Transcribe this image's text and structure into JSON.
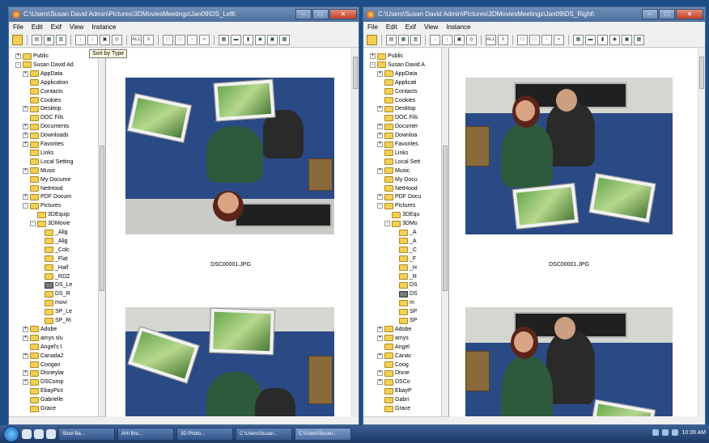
{
  "left_window": {
    "title": "C:\\Users\\Susan David Admin\\Pictures\\3DMoviesMeetings\\Jan09\\DS_Left\\",
    "menu": [
      "File",
      "Edit",
      "Exif",
      "View",
      "Instance"
    ],
    "tooltip": "Sort by Type",
    "tree": [
      {
        "label": "Public",
        "depth": 2,
        "exp": "+"
      },
      {
        "label": "Susan David Ad",
        "depth": 2,
        "exp": "-"
      },
      {
        "label": "AppData",
        "depth": 3,
        "exp": "+"
      },
      {
        "label": "Application",
        "depth": 3,
        "exp": ""
      },
      {
        "label": "Contacts",
        "depth": 3,
        "exp": ""
      },
      {
        "label": "Cookies",
        "depth": 3,
        "exp": ""
      },
      {
        "label": "Desktop",
        "depth": 3,
        "exp": "+"
      },
      {
        "label": "DOC Fils",
        "depth": 3,
        "exp": ""
      },
      {
        "label": "Documents",
        "depth": 3,
        "exp": "+"
      },
      {
        "label": "Downloads",
        "depth": 3,
        "exp": "+"
      },
      {
        "label": "Favorites",
        "depth": 3,
        "exp": "+"
      },
      {
        "label": "Links",
        "depth": 3,
        "exp": ""
      },
      {
        "label": "Local Setting",
        "depth": 3,
        "exp": ""
      },
      {
        "label": "Music",
        "depth": 3,
        "exp": "+"
      },
      {
        "label": "My Docume",
        "depth": 3,
        "exp": ""
      },
      {
        "label": "NetHood",
        "depth": 3,
        "exp": ""
      },
      {
        "label": "PDF Docum",
        "depth": 3,
        "exp": "+"
      },
      {
        "label": "Pictures",
        "depth": 3,
        "exp": "-"
      },
      {
        "label": "3DEquip",
        "depth": 4,
        "exp": ""
      },
      {
        "label": "3DMovie",
        "depth": 4,
        "exp": "-"
      },
      {
        "label": "_Alig",
        "depth": 5,
        "exp": ""
      },
      {
        "label": "_Alig",
        "depth": 5,
        "exp": ""
      },
      {
        "label": "_Colc",
        "depth": 5,
        "exp": ""
      },
      {
        "label": "_Flat",
        "depth": 5,
        "exp": ""
      },
      {
        "label": "_Half",
        "depth": 5,
        "exp": ""
      },
      {
        "label": "_RDZ",
        "depth": 5,
        "exp": ""
      },
      {
        "label": "DS_Le",
        "depth": 5,
        "exp": "",
        "img": true
      },
      {
        "label": "DS_R",
        "depth": 5,
        "exp": ""
      },
      {
        "label": "movi",
        "depth": 5,
        "exp": ""
      },
      {
        "label": "SP_Le",
        "depth": 5,
        "exp": ""
      },
      {
        "label": "SP_Ri",
        "depth": 5,
        "exp": ""
      },
      {
        "label": "Adobe",
        "depth": 3,
        "exp": "+"
      },
      {
        "label": "amys slu",
        "depth": 3,
        "exp": "+"
      },
      {
        "label": "Angel's I",
        "depth": 3,
        "exp": ""
      },
      {
        "label": "Canada2",
        "depth": 3,
        "exp": "+"
      },
      {
        "label": "Coogan",
        "depth": 3,
        "exp": ""
      },
      {
        "label": "Disneylar",
        "depth": 3,
        "exp": "+"
      },
      {
        "label": "DSComp",
        "depth": 3,
        "exp": "+"
      },
      {
        "label": "EbayPict",
        "depth": 3,
        "exp": ""
      },
      {
        "label": "Gabrielle",
        "depth": 3,
        "exp": ""
      },
      {
        "label": "Grace",
        "depth": 3,
        "exp": ""
      }
    ],
    "caption": "DSC00001.JPG"
  },
  "right_window": {
    "title": "C:\\Users\\Susan David Admin\\Pictures\\3DMoviesMeetings\\Jan09\\DS_Right\\",
    "menu": [
      "File",
      "Edit",
      "Exif",
      "View",
      "Instance"
    ],
    "tree": [
      {
        "label": "Public",
        "depth": 2,
        "exp": "+"
      },
      {
        "label": "Susan David A",
        "depth": 2,
        "exp": "-"
      },
      {
        "label": "AppData",
        "depth": 3,
        "exp": "+"
      },
      {
        "label": "Applicati",
        "depth": 3,
        "exp": ""
      },
      {
        "label": "Contacts",
        "depth": 3,
        "exp": ""
      },
      {
        "label": "Cookies",
        "depth": 3,
        "exp": ""
      },
      {
        "label": "Desktop",
        "depth": 3,
        "exp": "+"
      },
      {
        "label": "DOC Fils",
        "depth": 3,
        "exp": ""
      },
      {
        "label": "Documer",
        "depth": 3,
        "exp": "+"
      },
      {
        "label": "Downloa",
        "depth": 3,
        "exp": "+"
      },
      {
        "label": "Favorites",
        "depth": 3,
        "exp": "+"
      },
      {
        "label": "Links",
        "depth": 3,
        "exp": ""
      },
      {
        "label": "Local Sett",
        "depth": 3,
        "exp": ""
      },
      {
        "label": "Music",
        "depth": 3,
        "exp": "+"
      },
      {
        "label": "My Docu",
        "depth": 3,
        "exp": ""
      },
      {
        "label": "NetHood",
        "depth": 3,
        "exp": ""
      },
      {
        "label": "PDF Docu",
        "depth": 3,
        "exp": "+"
      },
      {
        "label": "Pictures",
        "depth": 3,
        "exp": "-"
      },
      {
        "label": "3DEqu",
        "depth": 4,
        "exp": ""
      },
      {
        "label": "3DMo",
        "depth": 4,
        "exp": "-"
      },
      {
        "label": "_A",
        "depth": 5,
        "exp": ""
      },
      {
        "label": "_A",
        "depth": 5,
        "exp": ""
      },
      {
        "label": "_C",
        "depth": 5,
        "exp": ""
      },
      {
        "label": "_F",
        "depth": 5,
        "exp": ""
      },
      {
        "label": "_H",
        "depth": 5,
        "exp": ""
      },
      {
        "label": "_R",
        "depth": 5,
        "exp": ""
      },
      {
        "label": "DS",
        "depth": 5,
        "exp": ""
      },
      {
        "label": "DS",
        "depth": 5,
        "exp": "",
        "img": true
      },
      {
        "label": "m",
        "depth": 5,
        "exp": ""
      },
      {
        "label": "SP",
        "depth": 5,
        "exp": ""
      },
      {
        "label": "SP",
        "depth": 5,
        "exp": ""
      },
      {
        "label": "Adobe",
        "depth": 3,
        "exp": "+"
      },
      {
        "label": "amys",
        "depth": 3,
        "exp": "+"
      },
      {
        "label": "Angel",
        "depth": 3,
        "exp": ""
      },
      {
        "label": "Canac",
        "depth": 3,
        "exp": "+"
      },
      {
        "label": "Coog",
        "depth": 3,
        "exp": ""
      },
      {
        "label": "Disne",
        "depth": 3,
        "exp": "+"
      },
      {
        "label": "DSCo",
        "depth": 3,
        "exp": "+"
      },
      {
        "label": "EbayP",
        "depth": 3,
        "exp": ""
      },
      {
        "label": "Gabri",
        "depth": 3,
        "exp": ""
      },
      {
        "label": "Grace",
        "depth": 3,
        "exp": ""
      }
    ],
    "caption": "DSC00001.JPG"
  },
  "toolbar_icons": [
    "folder-icon",
    "view-icon",
    "view-icon",
    "view-icon",
    "sort-name-icon",
    "sort-date-icon",
    "sort-type-icon",
    "sort-size-icon",
    "all-icon",
    "info-icon",
    "frame-icon",
    "frame-icon",
    "frame-icon",
    "more-icon",
    "grid-icon",
    "print-icon",
    "copy-icon",
    "camera-icon",
    "save-icon",
    "thumb-icon"
  ],
  "toolbar_glyphs": [
    "",
    "▤",
    "▦",
    "▥",
    "↓",
    "↓",
    "▣",
    "◎",
    "ALL",
    "≡",
    "□",
    "□",
    "▫",
    "«",
    "▦",
    "▬",
    "▮",
    "◉",
    "▣",
    "▩"
  ],
  "taskbar": {
    "tasks": [
      "Stool Ba...",
      "AHI Bro...",
      "3D Photo...",
      "C:\\Users\\Susan...",
      "C:\\Users\\Susan..."
    ],
    "clock": "10:39 AM"
  },
  "colors": {
    "titlebar": "#4e6f9c",
    "folder": "#f2cf57",
    "taskbar": "#1c3863"
  }
}
